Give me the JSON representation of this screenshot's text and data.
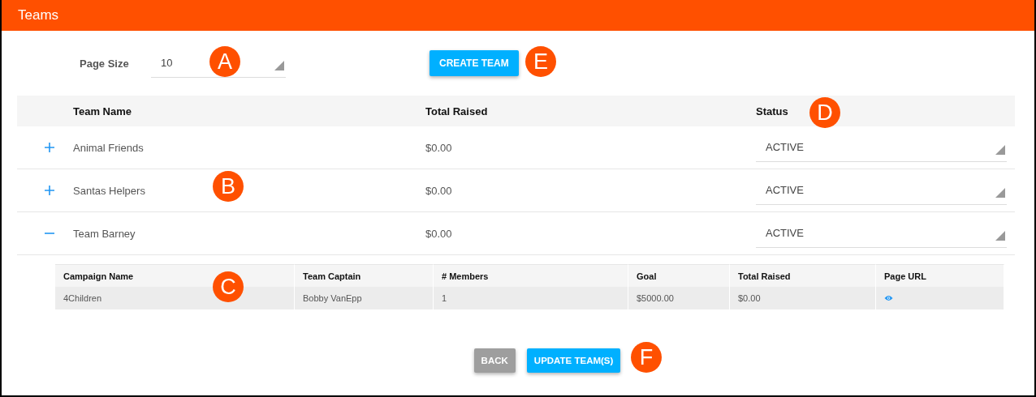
{
  "header": {
    "title": "Teams"
  },
  "page_size": {
    "label": "Page Size",
    "value": "10"
  },
  "create_button": "CREATE TEAM",
  "table": {
    "columns": [
      "Team Name",
      "Total Raised",
      "Status"
    ],
    "rows": [
      {
        "name": "Animal Friends",
        "total": "$0.00",
        "status": "ACTIVE",
        "expanded": false
      },
      {
        "name": "Santas Helpers",
        "total": "$0.00",
        "status": "ACTIVE",
        "expanded": false
      },
      {
        "name": "Team Barney",
        "total": "$0.00",
        "status": "ACTIVE",
        "expanded": true,
        "details": {
          "columns": [
            "Campaign Name",
            "Team Captain",
            "# Members",
            "Goal",
            "Total Raised",
            "Page URL"
          ],
          "rows": [
            {
              "cells": [
                "4Children",
                "Bobby VanEpp",
                "1",
                "$5000.00",
                "$0.00"
              ]
            }
          ]
        }
      }
    ]
  },
  "buttons": [
    {
      "label": "BACK",
      "kind": "secondary"
    },
    {
      "label": "UPDATE TEAM(S)",
      "kind": "primary"
    }
  ],
  "callouts": [
    {
      "letter": "A"
    },
    {
      "letter": "E"
    },
    {
      "letter": "D"
    },
    {
      "letter": "B"
    },
    {
      "letter": "C"
    },
    {
      "letter": "F"
    }
  ]
}
